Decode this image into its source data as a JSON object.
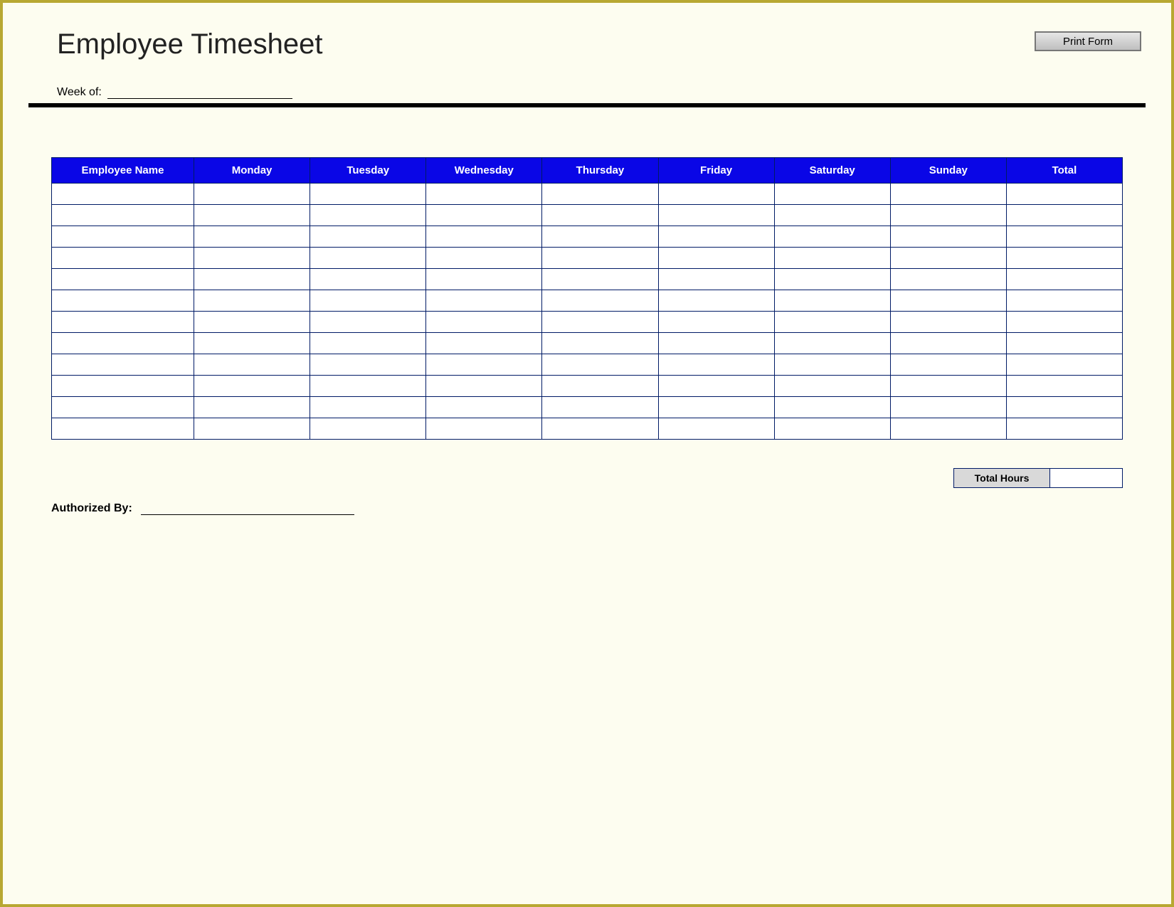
{
  "header": {
    "title": "Employee Timesheet",
    "print_label": "Print Form",
    "week_label": "Week of:"
  },
  "table": {
    "columns": [
      "Employee Name",
      "Monday",
      "Tuesday",
      "Wednesday",
      "Thursday",
      "Friday",
      "Saturday",
      "Sunday",
      "Total"
    ],
    "rows": [
      [
        "",
        "",
        "",
        "",
        "",
        "",
        "",
        "",
        ""
      ],
      [
        "",
        "",
        "",
        "",
        "",
        "",
        "",
        "",
        ""
      ],
      [
        "",
        "",
        "",
        "",
        "",
        "",
        "",
        "",
        ""
      ],
      [
        "",
        "",
        "",
        "",
        "",
        "",
        "",
        "",
        ""
      ],
      [
        "",
        "",
        "",
        "",
        "",
        "",
        "",
        "",
        ""
      ],
      [
        "",
        "",
        "",
        "",
        "",
        "",
        "",
        "",
        ""
      ],
      [
        "",
        "",
        "",
        "",
        "",
        "",
        "",
        "",
        ""
      ],
      [
        "",
        "",
        "",
        "",
        "",
        "",
        "",
        "",
        ""
      ],
      [
        "",
        "",
        "",
        "",
        "",
        "",
        "",
        "",
        ""
      ],
      [
        "",
        "",
        "",
        "",
        "",
        "",
        "",
        "",
        ""
      ],
      [
        "",
        "",
        "",
        "",
        "",
        "",
        "",
        "",
        ""
      ],
      [
        "",
        "",
        "",
        "",
        "",
        "",
        "",
        "",
        ""
      ]
    ]
  },
  "footer": {
    "total_hours_label": "Total Hours",
    "total_hours_value": "",
    "authorized_label": "Authorized By:"
  }
}
